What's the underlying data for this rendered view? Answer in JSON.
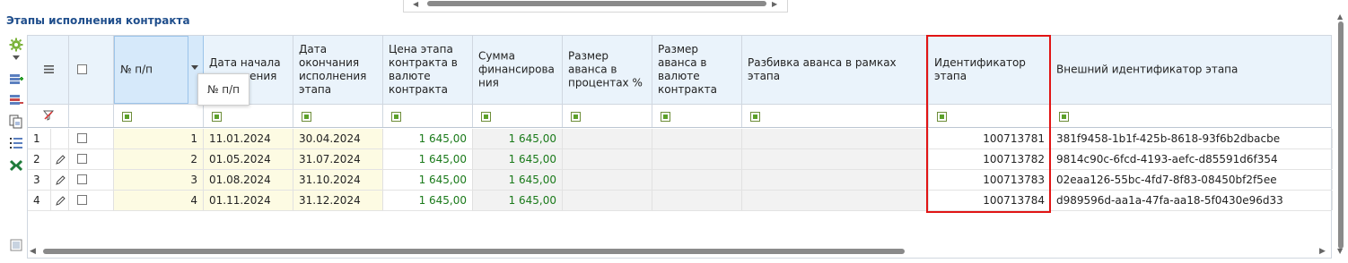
{
  "section": {
    "title": "Этапы исполнения контракта"
  },
  "columns": [
    {
      "key": "menu",
      "label": ""
    },
    {
      "key": "check",
      "label": ""
    },
    {
      "key": "num",
      "label": "№ п/п"
    },
    {
      "key": "start",
      "label": "Дата начала исполнения"
    },
    {
      "key": "end",
      "label": "Дата окончания исполнения этапа"
    },
    {
      "key": "price",
      "label": "Цена этапа контракта в валюте контракта"
    },
    {
      "key": "sum",
      "label": "Сумма финансирова ния"
    },
    {
      "key": "adv_pct",
      "label": "Размер аванса в процентах %"
    },
    {
      "key": "adv_cur",
      "label": "Размер аванса в валюте контракта"
    },
    {
      "key": "adv_split",
      "label": "Разбивка аванса в рамках этапа"
    },
    {
      "key": "stage_id",
      "label": "Идентификатор этапа"
    },
    {
      "key": "ext_id",
      "label": "Внешний идентификатор этапа"
    }
  ],
  "tooltip": "№ п/п",
  "rows": [
    {
      "row_num": "1",
      "num": "1",
      "start": "11.01.2024",
      "end": "30.04.2024",
      "price": "1 645,00",
      "sum": "1 645,00",
      "stage_id": "100713781",
      "ext_id": "381f9458-1b1f-425b-8618-93f6b2dbacbe"
    },
    {
      "row_num": "2",
      "num": "2",
      "start": "01.05.2024",
      "end": "31.07.2024",
      "price": "1 645,00",
      "sum": "1 645,00",
      "stage_id": "100713782",
      "ext_id": "9814c90c-6fcd-4193-aefc-d85591d6f354"
    },
    {
      "row_num": "3",
      "num": "3",
      "start": "01.08.2024",
      "end": "31.10.2024",
      "price": "1 645,00",
      "sum": "1 645,00",
      "stage_id": "100713783",
      "ext_id": "02eaa126-55bc-4fd7-8f83-08450bf2f5ee"
    },
    {
      "row_num": "4",
      "num": "4",
      "start": "01.11.2024",
      "end": "31.12.2024",
      "price": "1 645,00",
      "sum": "1 645,00",
      "stage_id": "100713784",
      "ext_id": "d989596d-aa1a-47fa-aa18-5f0430e96d33"
    }
  ],
  "colors": {
    "accent": "#1f4e8c",
    "highlight": "#e11414",
    "money": "#1a7a1a",
    "header_bg": "#eaf3fb"
  },
  "icons": [
    "settings-gear-icon",
    "add-row-icon",
    "delete-row-icon",
    "copy-row-icon",
    "list-numbered-icon",
    "excel-export-icon",
    "column-menu-icon",
    "clear-filter-icon",
    "edit-pencil-icon",
    "grid-settings-icon"
  ]
}
